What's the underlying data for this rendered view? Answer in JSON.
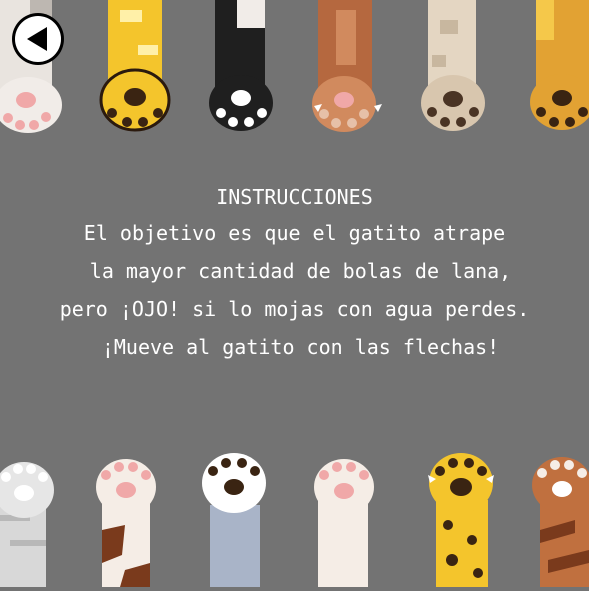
{
  "screen": "instructions",
  "back_button": {
    "icon": "back-arrow-icon"
  },
  "instructions": {
    "title": "INSTRUCCIONES",
    "lines": [
      "El objetivo es que el gatito atrape",
      " la mayor cantidad de bolas de lana,",
      "pero ¡OJO! si lo mojas con agua perdes.",
      " ¡Mueve al gatito con las flechas!"
    ]
  },
  "colors": {
    "background": "#737373",
    "text": "#ffffff"
  },
  "decor": {
    "top_paws": [
      "white-gray-cat-paw",
      "yellow-cat-paw",
      "black-white-cat-paw",
      "brown-cat-paw",
      "cream-spotted-cat-paw",
      "orange-cat-paw"
    ],
    "bottom_paws": [
      "gray-tabby-cat-paw",
      "calico-cat-paw",
      "blue-gray-cat-paw",
      "white-cat-paw",
      "leopard-cat-paw",
      "brown-tabby-cat-paw"
    ]
  }
}
